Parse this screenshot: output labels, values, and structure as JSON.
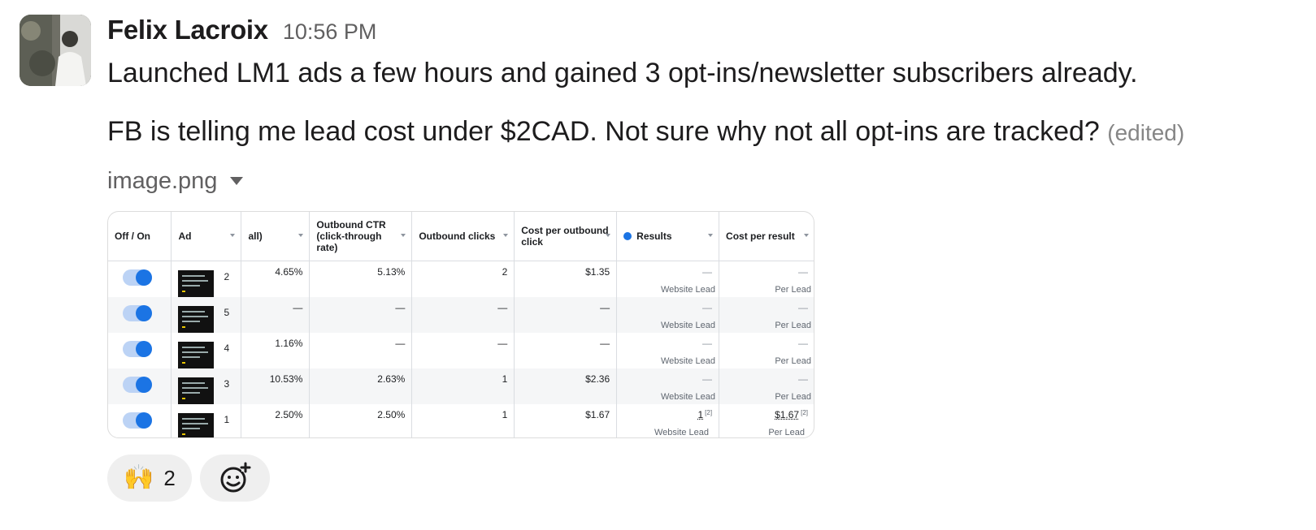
{
  "message": {
    "sender": "Felix Lacroix",
    "timestamp": "10:56 PM",
    "line1": "Launched LM1 ads a few hours and gained 3 opt-ins/newsletter subscribers already.",
    "line2": "FB is telling me lead cost under $2CAD. Not sure why not all opt-ins are tracked?",
    "edited_label": "(edited)"
  },
  "attachment": {
    "file_name": "image.png"
  },
  "ads_table": {
    "headers": {
      "off_on": "Off / On",
      "ad": "Ad",
      "ctr_all": "all)",
      "outbound_ctr": "Outbound CTR (click-through rate)",
      "outbound_clicks": "Outbound clicks",
      "cost_per_outbound": "Cost per outbound click",
      "results": "Results",
      "cost_per_result": "Cost per result"
    },
    "result_sublabel": "Website Lead",
    "cost_sublabel": "Per Lead",
    "rows": [
      {
        "ad": "2",
        "ctr_all": "4.65%",
        "outbound_ctr": "5.13%",
        "outbound_clicks": "2",
        "cost_per_outbound": "$1.35",
        "results": "—",
        "cost_per_result": "—"
      },
      {
        "ad": "5",
        "ctr_all": "—",
        "outbound_ctr": "—",
        "outbound_clicks": "—",
        "cost_per_outbound": "—",
        "results": "—",
        "cost_per_result": "—"
      },
      {
        "ad": "4",
        "ctr_all": "1.16%",
        "outbound_ctr": "—",
        "outbound_clicks": "—",
        "cost_per_outbound": "—",
        "results": "—",
        "cost_per_result": "—"
      },
      {
        "ad": "3",
        "ctr_all": "10.53%",
        "outbound_ctr": "2.63%",
        "outbound_clicks": "1",
        "cost_per_outbound": "$2.36",
        "results": "—",
        "cost_per_result": "—"
      },
      {
        "ad": "1",
        "ctr_all": "2.50%",
        "outbound_ctr": "2.50%",
        "outbound_clicks": "1",
        "cost_per_outbound": "$1.67",
        "results": "1",
        "cost_per_result": "$1.67"
      }
    ],
    "footnote_mark": "[2]"
  },
  "reactions": [
    {
      "emoji": "🙌",
      "icon": "raised-hands-icon",
      "count": "2"
    }
  ],
  "add_reaction_icon": "add-emoji-icon"
}
